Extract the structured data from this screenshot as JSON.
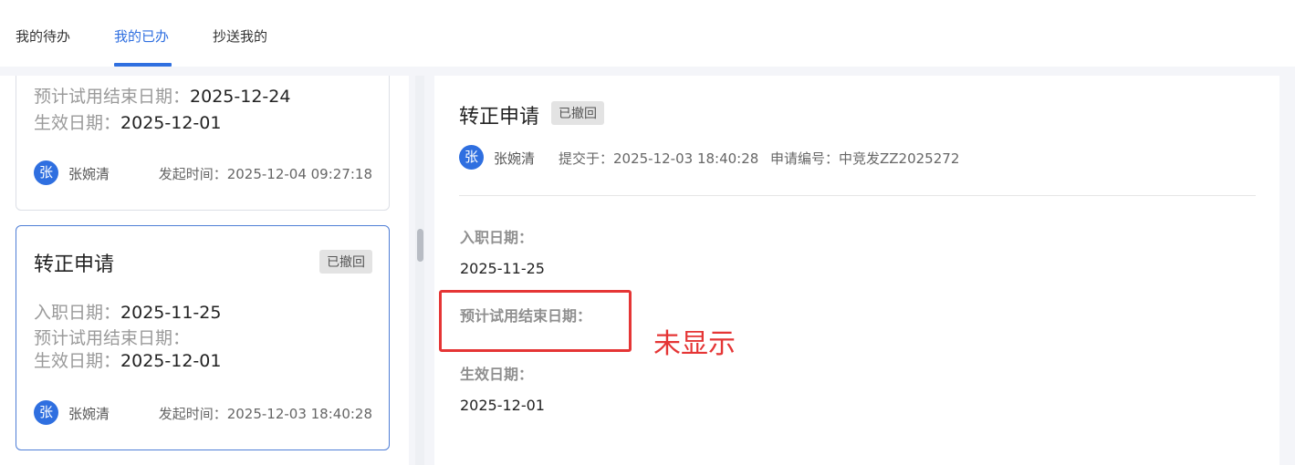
{
  "tabs": {
    "pending": "我的待办",
    "done": "我的已办",
    "cc": "抄送我的"
  },
  "cards": [
    {
      "lines": [
        {
          "label": "预计试用结束日期：",
          "value": "2025-12-24"
        },
        {
          "label": "生效日期：",
          "value": "2025-12-01"
        }
      ],
      "avatar": "张",
      "user": "张婉清",
      "time": "发起时间：2025-12-04 09:27:18"
    },
    {
      "title": "转正申请",
      "badge": "已撤回",
      "lines": [
        {
          "label": "入职日期：",
          "value": "2025-11-25"
        },
        {
          "label": "预计试用结束日期：",
          "value": ""
        },
        {
          "label": "生效日期：",
          "value": "2025-12-01"
        }
      ],
      "avatar": "张",
      "user": "张婉清",
      "time": "发起时间：2025-12-03 18:40:28"
    }
  ],
  "detail": {
    "title": "转正申请",
    "badge": "已撤回",
    "avatar": "张",
    "user": "张婉清",
    "submitted": "提交于：2025-12-03 18:40:28",
    "app_no": "申请编号：中竞发ZZ2025272",
    "fields": [
      {
        "label": "入职日期：",
        "value": "2025-11-25"
      },
      {
        "label": "预计试用结束日期：",
        "value": ""
      },
      {
        "label": "生效日期：",
        "value": "2025-12-01"
      }
    ]
  },
  "annotation": {
    "text": "未显示",
    "color": "#e53535"
  },
  "colors": {
    "accent": "#2f6fe0",
    "badge_bg": "#e3e3e3"
  }
}
